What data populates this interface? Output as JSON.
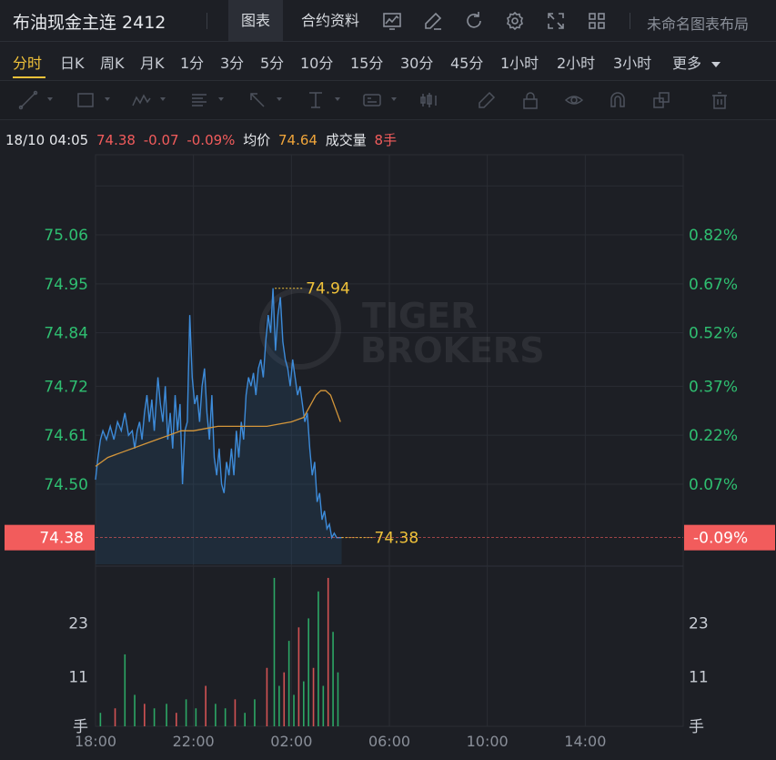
{
  "header": {
    "title": "布油现金主连 2412",
    "tabs": [
      {
        "label": "图表",
        "active": true
      },
      {
        "label": "合约资料",
        "active": false
      }
    ],
    "layout_name": "未命名图表布局",
    "icons": [
      "line-chart-icon",
      "edit-icon",
      "refresh-icon",
      "settings-icon",
      "fullscreen-icon",
      "grid-layout-icon"
    ]
  },
  "periods": {
    "items": [
      "分时",
      "日K",
      "周K",
      "月K",
      "1分",
      "3分",
      "5分",
      "10分",
      "15分",
      "30分",
      "45分",
      "1小时",
      "2小时",
      "3小时",
      "更多"
    ],
    "active": "分时"
  },
  "drawing_toolbar": {
    "icons": [
      "trend-line-icon",
      "rectangle-icon",
      "pattern-icon",
      "fibonacci-icon",
      "arrow-icon",
      "measure-icon",
      "text-icon",
      "indicator-icon",
      "pencil-icon",
      "lock-icon",
      "eye-icon",
      "magnet-icon",
      "clone-icon",
      "trash-icon"
    ]
  },
  "info": {
    "datetime": "18/10 04:05",
    "price": "74.38",
    "change": "-0.07",
    "change_pct": "-0.09%",
    "avg_label": "均价",
    "avg_value": "74.64",
    "volume_label": "成交量",
    "volume_value": "8手"
  },
  "watermark": {
    "line1": "TIGER",
    "line2": "BROKERS"
  },
  "colors": {
    "price_line": "#3d8bd9",
    "avg_line": "#d4963a",
    "axis_label_green": "#2fbf71",
    "up_red": "#f25c5c",
    "marker_yellow": "#f0c23a",
    "grid": "#2a2d34"
  },
  "chart_data": {
    "type": "line",
    "x_ticks": [
      "18:00",
      "22:00",
      "02:00",
      "06:00",
      "10:00",
      "14:00"
    ],
    "y_left_ticks": [
      "75.06",
      "74.95",
      "74.84",
      "74.72",
      "74.61",
      "74.50"
    ],
    "y_right_ticks": [
      "0.82%",
      "0.67%",
      "0.52%",
      "0.37%",
      "0.22%",
      "0.07%"
    ],
    "ylim": [
      74.32,
      75.24
    ],
    "current_price": 74.38,
    "current_price_label": "74.38",
    "current_pct_label": "-0.09%",
    "high_marker": 74.94,
    "high_marker_label": "74.94",
    "last_marker_label": "74.38",
    "volume_ticks": [
      "23",
      "11"
    ],
    "volume_unit": "手",
    "volume_ylim": [
      0,
      34
    ],
    "price_series": {
      "hours": [
        0.0,
        0.1,
        0.2,
        0.3,
        0.45,
        0.6,
        0.75,
        0.9,
        1.05,
        1.2,
        1.35,
        1.5,
        1.6,
        1.7,
        1.8,
        1.9,
        2.0,
        2.1,
        2.2,
        2.3,
        2.4,
        2.55,
        2.65,
        2.75,
        2.85,
        2.95,
        3.05,
        3.15,
        3.25,
        3.35,
        3.45,
        3.55,
        3.65,
        3.75,
        3.85,
        3.95,
        4.05,
        4.15,
        4.25,
        4.35,
        4.45,
        4.55,
        4.65,
        4.75,
        4.85,
        4.95,
        5.05,
        5.15,
        5.25,
        5.35,
        5.45,
        5.55,
        5.65,
        5.75,
        5.85,
        5.95,
        6.05,
        6.15,
        6.25,
        6.35,
        6.45,
        6.55,
        6.65,
        6.75,
        6.85,
        6.95,
        7.05,
        7.15,
        7.25,
        7.35,
        7.45,
        7.55,
        7.65,
        7.75,
        7.85,
        7.95,
        8.05,
        8.15,
        8.25,
        8.35,
        8.45,
        8.55,
        8.65,
        8.75,
        8.85,
        8.95,
        9.05,
        9.15,
        9.25,
        9.35,
        9.45,
        9.55,
        9.65,
        9.75,
        9.85,
        9.95,
        10.05
      ],
      "values": [
        74.51,
        74.56,
        74.6,
        74.62,
        74.6,
        74.63,
        74.6,
        74.64,
        74.62,
        74.66,
        74.61,
        74.62,
        74.58,
        74.62,
        74.64,
        74.6,
        74.66,
        74.7,
        74.64,
        74.69,
        74.62,
        74.74,
        74.68,
        74.64,
        74.72,
        74.6,
        74.66,
        74.58,
        74.7,
        74.62,
        74.68,
        74.5,
        74.62,
        74.64,
        74.88,
        74.74,
        74.68,
        74.7,
        74.64,
        74.72,
        74.76,
        74.66,
        74.6,
        74.7,
        74.56,
        74.52,
        74.58,
        74.5,
        74.48,
        74.55,
        74.52,
        74.58,
        74.52,
        74.62,
        74.56,
        74.64,
        74.6,
        74.7,
        74.74,
        74.72,
        74.75,
        74.7,
        74.76,
        74.78,
        74.74,
        74.82,
        74.88,
        74.84,
        74.94,
        74.8,
        74.88,
        74.92,
        74.82,
        74.78,
        74.76,
        74.72,
        74.78,
        74.74,
        74.7,
        74.72,
        74.68,
        74.64,
        74.66,
        74.58,
        74.52,
        74.55,
        74.46,
        74.48,
        74.42,
        74.44,
        74.4,
        74.41,
        74.38,
        74.39,
        74.38,
        74.38,
        74.38
      ]
    },
    "avg_series": {
      "hours": [
        0.0,
        0.5,
        1.0,
        1.5,
        2.0,
        2.5,
        3.0,
        3.5,
        4.0,
        4.5,
        5.0,
        5.5,
        6.0,
        6.5,
        7.0,
        7.5,
        8.0,
        8.5,
        8.8,
        9.0,
        9.2,
        9.4,
        9.6,
        9.8,
        10.0
      ],
      "values": [
        74.54,
        74.56,
        74.57,
        74.58,
        74.59,
        74.6,
        74.61,
        74.62,
        74.62,
        74.625,
        74.63,
        74.63,
        74.63,
        74.63,
        74.63,
        74.635,
        74.64,
        74.65,
        74.68,
        74.7,
        74.71,
        74.71,
        74.7,
        74.67,
        74.64
      ]
    },
    "volume_series": {
      "hours": [
        0.2,
        0.8,
        1.2,
        1.6,
        2.0,
        2.4,
        2.9,
        3.3,
        3.7,
        4.1,
        4.5,
        4.9,
        5.3,
        5.7,
        6.1,
        6.5,
        7.0,
        7.3,
        7.5,
        7.7,
        7.9,
        8.1,
        8.3,
        8.5,
        8.7,
        8.9,
        9.1,
        9.3,
        9.5,
        9.7,
        9.9
      ],
      "values": [
        3,
        4,
        16,
        7,
        5,
        4,
        5,
        3,
        6,
        4,
        9,
        5,
        4,
        6,
        3,
        6,
        13,
        33,
        9,
        12,
        19,
        7,
        22,
        10,
        24,
        13,
        30,
        9,
        33,
        21,
        12
      ]
    }
  }
}
